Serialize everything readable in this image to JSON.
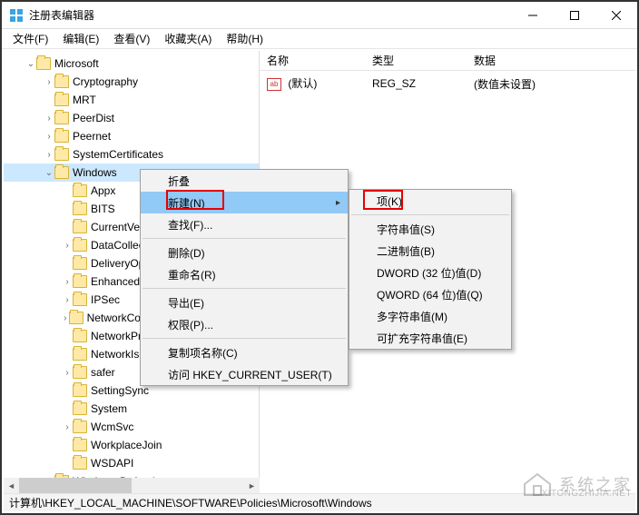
{
  "window": {
    "title": "注册表编辑器"
  },
  "menubar": {
    "file": "文件(F)",
    "edit": "编辑(E)",
    "view": "查看(V)",
    "favorites": "收藏夹(A)",
    "help": "帮助(H)"
  },
  "tree": {
    "rows": [
      {
        "indent": 24,
        "caret": "v",
        "label": "Microsoft"
      },
      {
        "indent": 44,
        "caret": ">",
        "label": "Cryptography"
      },
      {
        "indent": 44,
        "caret": "",
        "label": "MRT"
      },
      {
        "indent": 44,
        "caret": ">",
        "label": "PeerDist"
      },
      {
        "indent": 44,
        "caret": ">",
        "label": "Peernet"
      },
      {
        "indent": 44,
        "caret": ">",
        "label": "SystemCertificates"
      },
      {
        "indent": 44,
        "caret": "v",
        "label": "Windows",
        "selected": true
      },
      {
        "indent": 64,
        "caret": "",
        "label": "Appx"
      },
      {
        "indent": 64,
        "caret": "",
        "label": "BITS"
      },
      {
        "indent": 64,
        "caret": "",
        "label": "CurrentVersion"
      },
      {
        "indent": 64,
        "caret": ">",
        "label": "DataCollection"
      },
      {
        "indent": 64,
        "caret": "",
        "label": "DeliveryOptimization"
      },
      {
        "indent": 64,
        "caret": ">",
        "label": "EnhancedStorageDevices"
      },
      {
        "indent": 64,
        "caret": ">",
        "label": "IPSec"
      },
      {
        "indent": 64,
        "caret": ">",
        "label": "NetworkConnectivityStatusIndicator"
      },
      {
        "indent": 64,
        "caret": "",
        "label": "NetworkProvider"
      },
      {
        "indent": 64,
        "caret": "",
        "label": "NetworkIsolation"
      },
      {
        "indent": 64,
        "caret": ">",
        "label": "safer"
      },
      {
        "indent": 64,
        "caret": "",
        "label": "SettingSync"
      },
      {
        "indent": 64,
        "caret": "",
        "label": "System"
      },
      {
        "indent": 64,
        "caret": ">",
        "label": "WcmSvc"
      },
      {
        "indent": 64,
        "caret": "",
        "label": "WorkplaceJoin"
      },
      {
        "indent": 64,
        "caret": "",
        "label": "WSDAPI"
      },
      {
        "indent": 44,
        "caret": ">",
        "label": "Windows Defender"
      }
    ]
  },
  "list": {
    "headers": {
      "name": "名称",
      "type": "类型",
      "data": "数据"
    },
    "rows": [
      {
        "name": "(默认)",
        "type": "REG_SZ",
        "data": "(数值未设置)"
      }
    ],
    "icon_text": "ab"
  },
  "context_menu_1": {
    "items": [
      {
        "label": "折叠"
      },
      {
        "label": "新建(N)",
        "hover": true,
        "submenu": true
      },
      {
        "label": "查找(F)..."
      },
      {
        "sep": true
      },
      {
        "label": "删除(D)"
      },
      {
        "label": "重命名(R)"
      },
      {
        "sep": true
      },
      {
        "label": "导出(E)"
      },
      {
        "label": "权限(P)..."
      },
      {
        "sep": true
      },
      {
        "label": "复制项名称(C)"
      },
      {
        "label": "访问 HKEY_CURRENT_USER(T)"
      }
    ]
  },
  "context_menu_2": {
    "items": [
      {
        "label": "项(K)"
      },
      {
        "sep": true
      },
      {
        "label": "字符串值(S)"
      },
      {
        "label": "二进制值(B)"
      },
      {
        "label": "DWORD (32 位)值(D)"
      },
      {
        "label": "QWORD (64 位)值(Q)"
      },
      {
        "label": "多字符串值(M)"
      },
      {
        "label": "可扩充字符串值(E)"
      }
    ]
  },
  "statusbar": {
    "path": "计算机\\HKEY_LOCAL_MACHINE\\SOFTWARE\\Policies\\Microsoft\\Windows"
  },
  "watermark": {
    "cn": "系统之家",
    "en": "XITONGZHIJIA.NET"
  }
}
